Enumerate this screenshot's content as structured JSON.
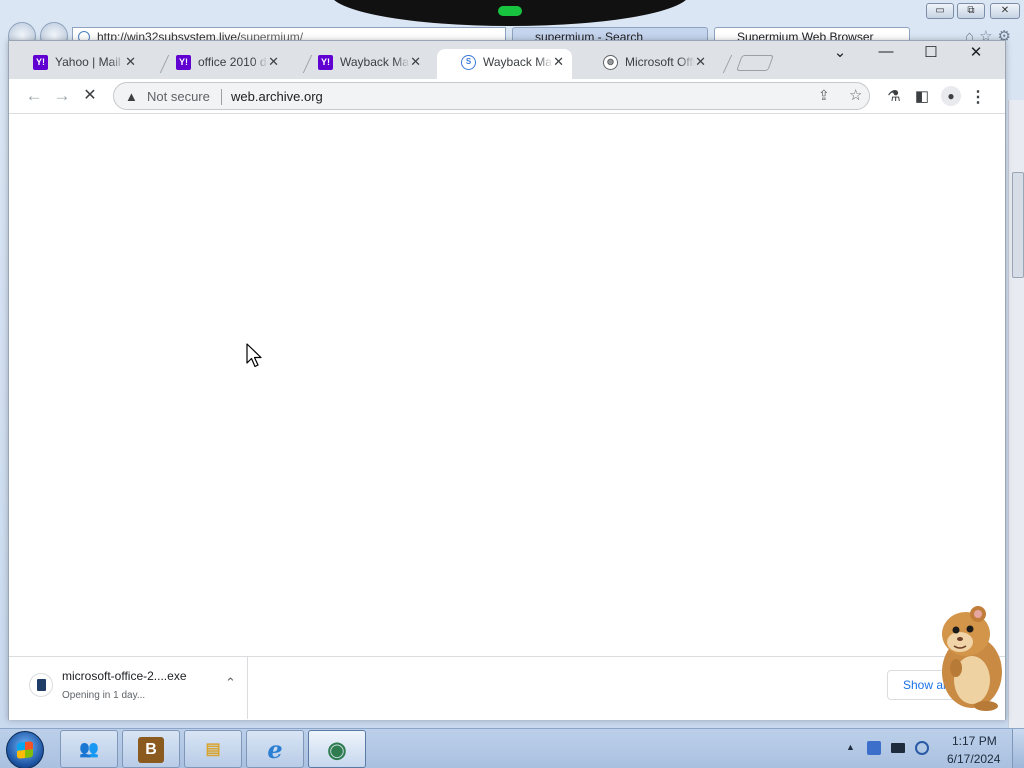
{
  "ie": {
    "address": "http://win32subsystem.live/",
    "address_tail": "supermium/",
    "tabs": [
      {
        "label": "supermium - Search"
      },
      {
        "label": "Supermium Web Browser"
      }
    ],
    "min_glyph": "▭",
    "max_glyph": "⧉",
    "close_glyph": "✕",
    "right_icons": "⌂☆⚙"
  },
  "chrome": {
    "tabs": [
      {
        "label": "Yahoo | Mail",
        "favicon": "yahoo-icon",
        "fav_text": "Y!",
        "active": false
      },
      {
        "label": "office 2010 do",
        "favicon": "yahoo-icon",
        "fav_text": "Y!",
        "active": false
      },
      {
        "label": "Wayback Mac",
        "favicon": "yahoo-icon",
        "fav_text": "Y!",
        "active": false
      },
      {
        "label": "Wayback Mac",
        "favicon": "internet-archive-icon",
        "fav_text": "S",
        "active": true
      },
      {
        "label": "Microsoft Offi",
        "favicon": "globe-icon",
        "fav_text": "◍",
        "active": false
      }
    ],
    "tab_close_glyph": "✕",
    "window_controls": {
      "list": "⌄",
      "min": "—",
      "max": "☐",
      "close": "✕"
    },
    "toolbar": {
      "back_glyph": "←",
      "forward_glyph": "→",
      "stop_glyph": "✕",
      "security_warning_glyph": "▲",
      "security_label": "Not secure",
      "url": "web.archive.org",
      "share_glyph": "⇪",
      "star_glyph": "☆",
      "extension_glyph": "⚗",
      "sidepanel_glyph": "◧",
      "profile_glyph": "●",
      "menu_glyph": "⋮"
    },
    "download": {
      "filename": "microsoft-office-2....exe",
      "status": "Opening in 1 day...",
      "chevron_glyph": "⌃",
      "show_all_label": "Show all"
    }
  },
  "taskbar": {
    "apps": [
      {
        "name": "windows-live-messenger-app",
        "glyph": "👥",
        "color": "#2e7bd6"
      },
      {
        "name": "boxed-app",
        "glyph": "B",
        "color": "#8a5a1e"
      },
      {
        "name": "windows-explorer-app",
        "glyph": "▤",
        "color": "#d9a531"
      },
      {
        "name": "internet-explorer-app",
        "glyph": "e",
        "color": "#2a7fd4"
      },
      {
        "name": "chrome-app",
        "glyph": "◉",
        "color": "#2f7d4f"
      }
    ],
    "time": "1:17 PM",
    "date": "6/17/2024",
    "tray_arrow": "▲"
  },
  "colors": {
    "accent_link": "#1a73e8",
    "yahoo_purple": "#6001d2",
    "taskbar_bg": "#bcd0ea"
  }
}
